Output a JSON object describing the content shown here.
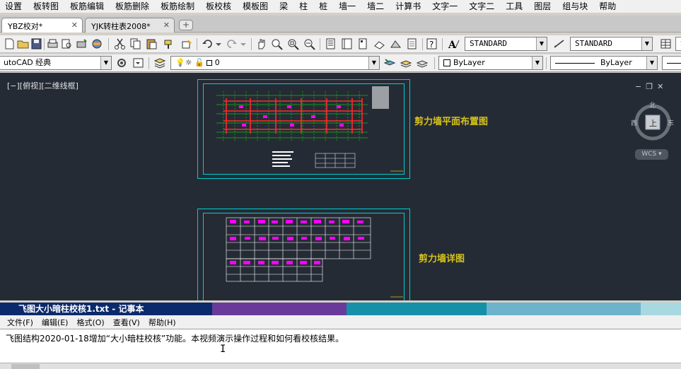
{
  "menu": [
    "设置",
    "板转图",
    "板筋编辑",
    "板筋删除",
    "板筋绘制",
    "板校核",
    "模板图",
    "梁",
    "柱",
    "桩",
    "墙一",
    "墙二",
    "计算书",
    "文字一",
    "文字二",
    "工具",
    "图层",
    "组与块",
    "帮助"
  ],
  "tabs": [
    {
      "label": "YBZ校对*",
      "close": "✕"
    },
    {
      "label": "YJK转柱表2008*",
      "close": "✕"
    }
  ],
  "tab_add": "+",
  "toolbar": {
    "text_style": "STANDARD",
    "dim_style": "STANDARD",
    "table_style": "S"
  },
  "toolbar2": {
    "workspace": "utoCAD 经典",
    "layer": "0",
    "color": "ByLayer",
    "linetype": "ByLayer"
  },
  "viewport": {
    "label": "[−][俯视][二维线框]",
    "controls": [
      "−",
      "❐",
      "✕"
    ],
    "compass": {
      "north": "北",
      "south": "南",
      "east": "东",
      "west": "西",
      "top": "上"
    },
    "wcs": "WCS ▾"
  },
  "sheets": [
    {
      "title": "剪力墙平面布置图"
    },
    {
      "title": "剪力墙详图"
    }
  ],
  "notepad": {
    "title": "飞图大小暗柱校核1.txt - 记事本",
    "menu": [
      "文件(F)",
      "编辑(E)",
      "格式(O)",
      "查看(V)",
      "帮助(H)"
    ],
    "text": "飞图结构2020-01-18增加“大小暗柱校核”功能。本视频演示操作过程和如何看校核结果。"
  },
  "colors": {
    "canvas": "#252b35",
    "frame": "#00cdd0",
    "title": "#d6c21a",
    "wall": "#ff2a2a",
    "axis": "#00ff00",
    "detail": "#ff00ff"
  }
}
